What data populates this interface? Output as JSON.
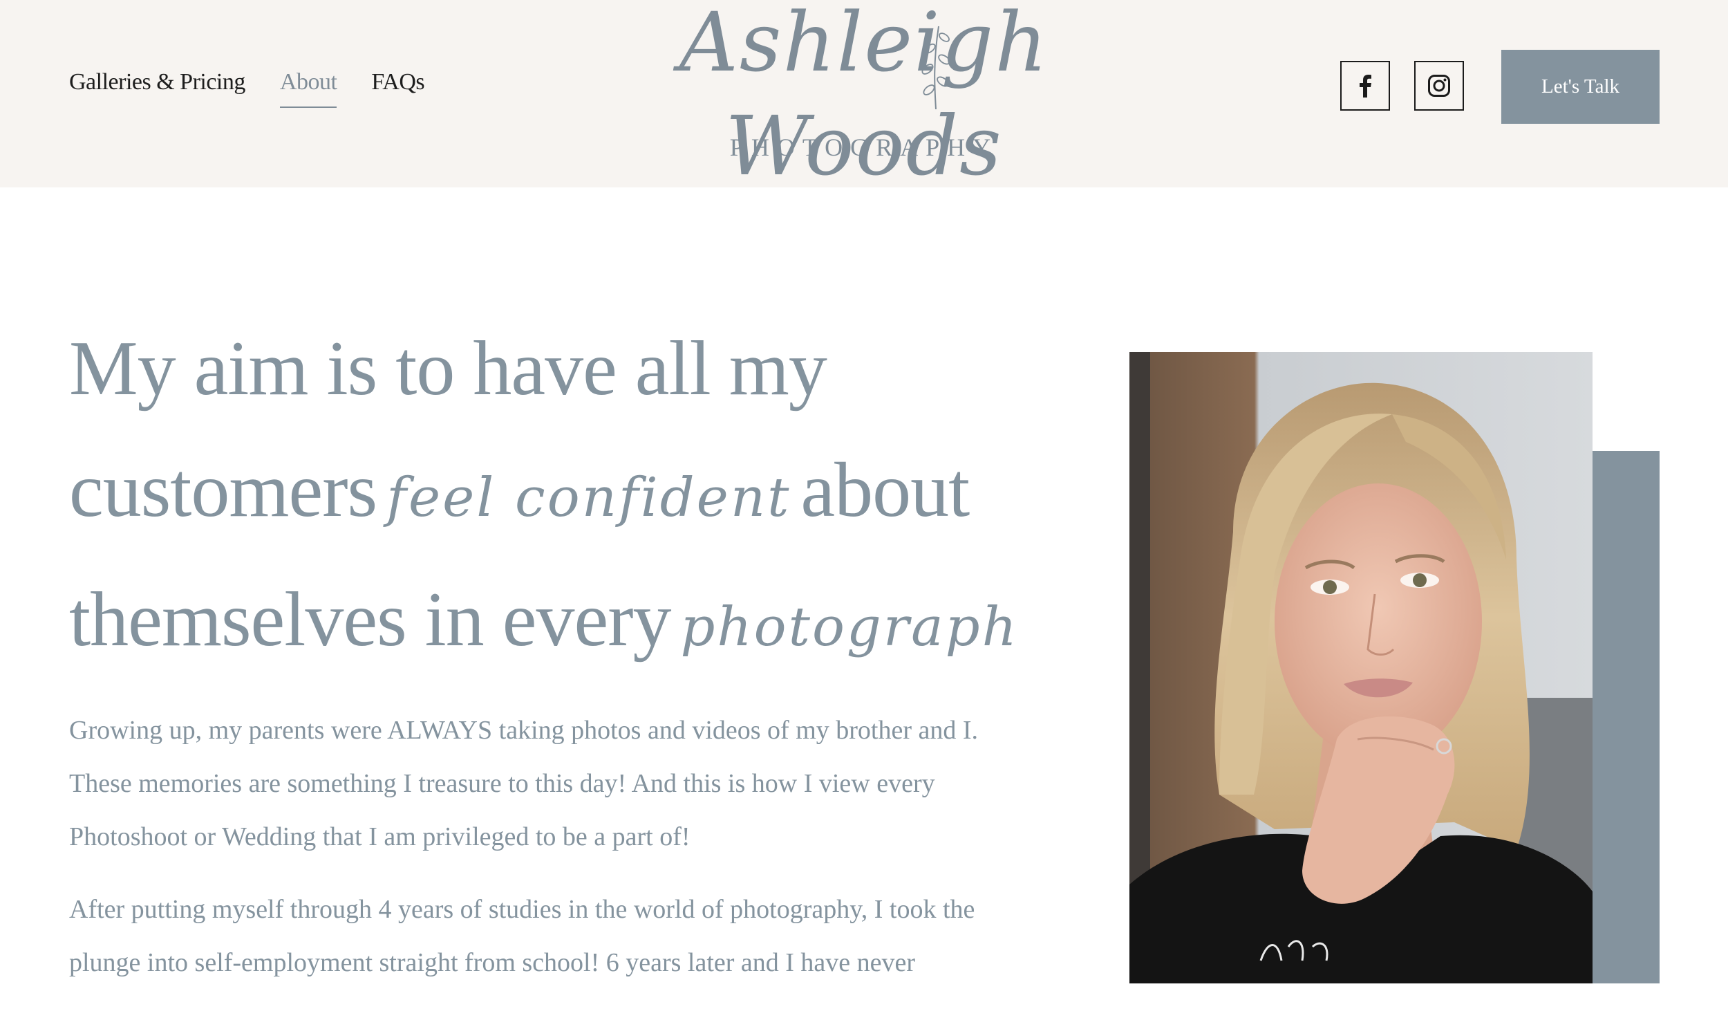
{
  "nav": {
    "items": [
      {
        "label": "Galleries & Pricing",
        "active": false
      },
      {
        "label": "About",
        "active": true
      },
      {
        "label": "FAQs",
        "active": false
      }
    ]
  },
  "logo": {
    "script_text": "Ashleigh Woods",
    "sub_text": "PHOTOGRAPHY"
  },
  "social": {
    "facebook_icon": "facebook-icon",
    "instagram_icon": "instagram-icon"
  },
  "cta": {
    "label": "Let's Talk"
  },
  "headline": {
    "line1": "My aim is to have all my",
    "line2_start": "customers",
    "line2_script": "feel confident",
    "line2_end": "about",
    "line3_start": "themselves in every",
    "line3_script": "photograph"
  },
  "body": {
    "paragraph1": "Growing up, my parents were ALWAYS taking photos and videos of my brother and I. These memories are something I treasure to this day! And this is how I view every Photoshoot or Wedding that I am privileged to be a part of!",
    "paragraph2": "After putting myself through 4 years of studies in the world of photography, I took the plunge into self-employment straight from school! 6 years later and I have never"
  },
  "colors": {
    "header_bg": "#f7f4f1",
    "accent": "#84939e",
    "nav_text": "#1d1d1d",
    "button_text": "#ffffff"
  }
}
